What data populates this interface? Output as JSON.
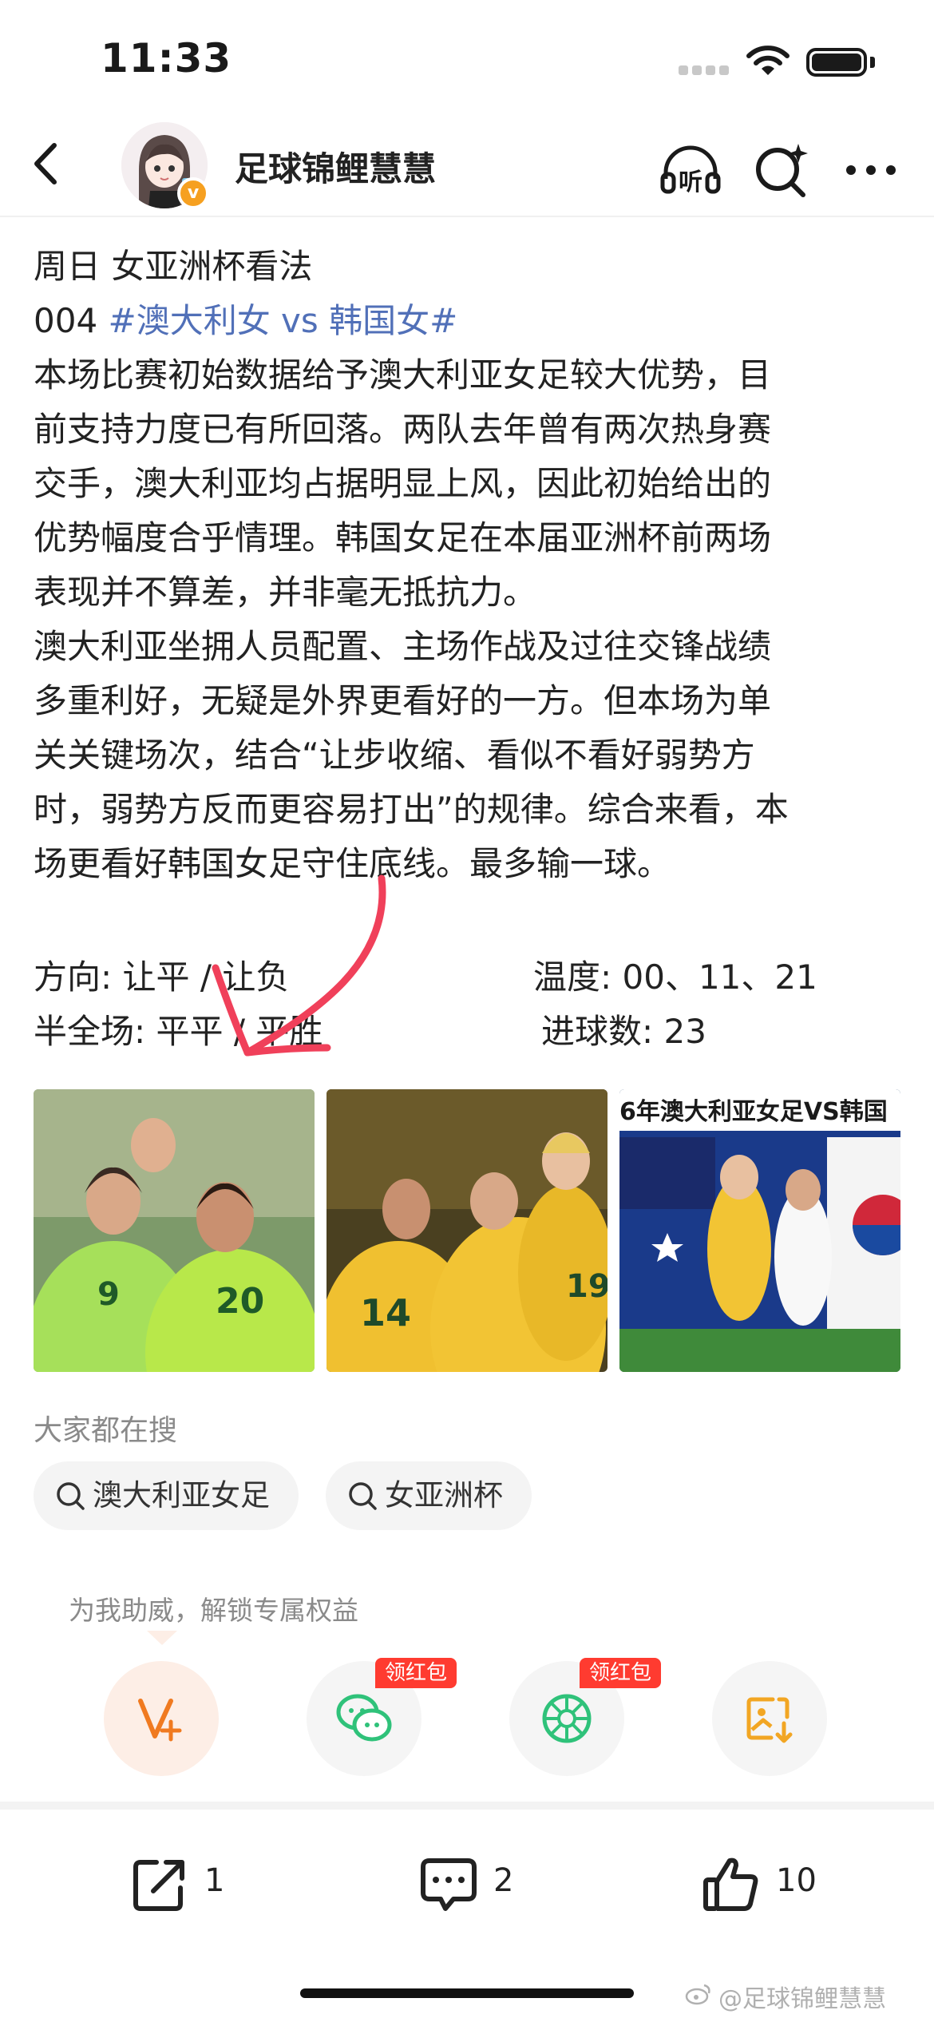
{
  "status_bar": {
    "time": "11:33"
  },
  "header": {
    "author_name": "足球锦鲤慧慧",
    "verified_mark": "v",
    "icons": [
      "back-icon",
      "listen-icon",
      "search-sparkle-icon",
      "more-icon"
    ],
    "listen_label": "听"
  },
  "article": {
    "line1": "周日 女亚洲杯看法",
    "line2_prefix": "004 ",
    "topic": "#澳大利女 vs 韩国女#",
    "body_lines": [
      "本场比赛初始数据给予澳大利亚女足较大优势，目",
      "前支持力度已有所回落。两队去年曾有两次热身赛",
      "交手，澳大利亚均占据明显上风，因此初始给出的",
      "优势幅度合乎情理。韩国女足在本届亚洲杯前两场",
      "表现并不算差，并非毫无抵抗力。",
      "澳大利亚坐拥人员配置、主场作战及过往交锋战绩",
      "多重利好，无疑是外界更看好的一方。但本场为单",
      "关关键场次，结合“让步收缩、看似不看好弱势方",
      "时，弱势方反而更容易打出”的规律。综合来看，本",
      "场更看好韩国女足守住底线。最多输一球。"
    ]
  },
  "stats": {
    "direction": "方向: 让平 / 让负",
    "temperature": "温度: 00、11、21",
    "half_full": "半全场: 平平 / 平胜",
    "goals": "进球数: 23"
  },
  "photos": {
    "photo3_caption": "6年澳大利亚女足VS韩国"
  },
  "search": {
    "title": "大家都在搜",
    "chips": [
      "澳大利亚女足",
      "女亚洲杯"
    ]
  },
  "support": {
    "tip": "为我助威，解锁专属权益",
    "badge_label": "领红包",
    "icons": [
      "vip-plus-icon",
      "wechat-icon",
      "moments-icon",
      "save-image-icon"
    ]
  },
  "bottom_bar": {
    "share_count": "1",
    "comment_count": "2",
    "like_count": "10"
  },
  "watermark": "@足球锦鲤慧慧",
  "colors": {
    "topic": "#5170b8",
    "accent_orange": "#f6a020",
    "badge_red": "#ff3b30",
    "wechat_green": "#2fc27a",
    "annotation_red": "#f0405a"
  }
}
